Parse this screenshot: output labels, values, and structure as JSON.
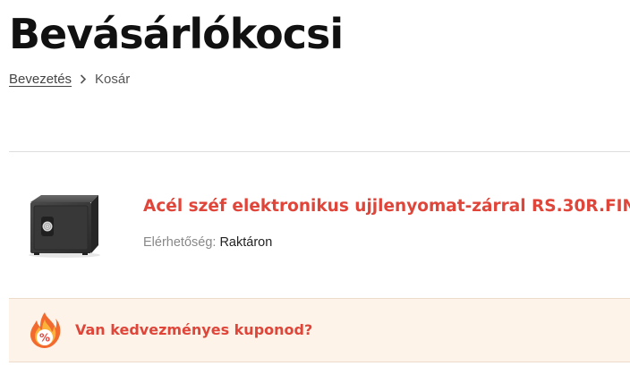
{
  "page": {
    "title": "Bevásárlókocsi"
  },
  "breadcrumb": {
    "items": [
      {
        "label": "Bevezetés",
        "link": true
      },
      {
        "label": "Kosár",
        "link": false
      }
    ],
    "separator_icon": "chevron-right-icon"
  },
  "cart": {
    "items": [
      {
        "name": "Acél széf elektronikus ujjlenyomat-zárral RS.30R.FIN",
        "availability_label": "Elérhetőség:",
        "availability_value": "Raktáron",
        "image": "safe-product-image"
      }
    ]
  },
  "coupon": {
    "text": "Van kedvezményes kuponod?",
    "icon": "fire-percent-icon",
    "icon_symbol": "%"
  },
  "colors": {
    "accent": "#e0453a",
    "coupon_bg": "#fdf3e8",
    "title": "#111111"
  }
}
